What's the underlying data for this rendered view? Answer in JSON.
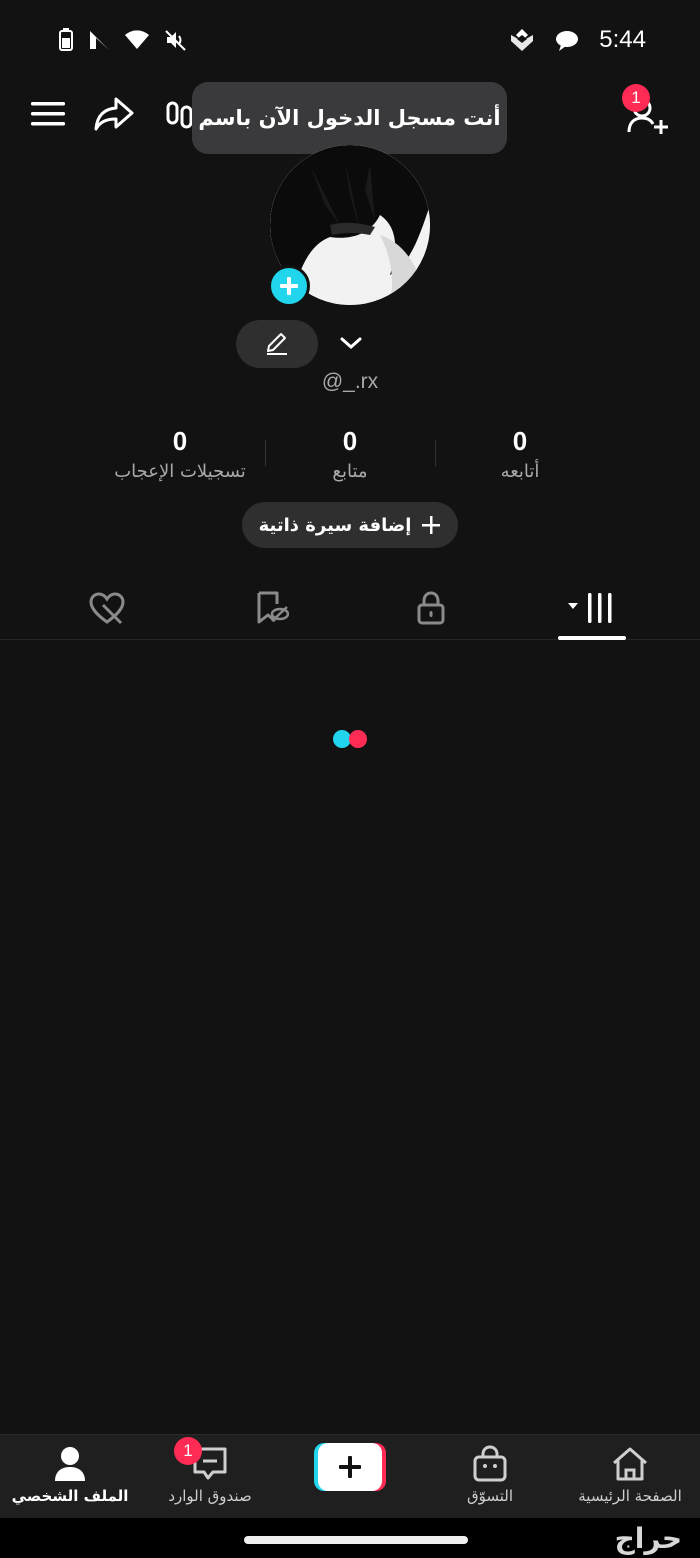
{
  "status_bar": {
    "time": "5:44",
    "left_icons": [
      "battery-saver-icon",
      "signal-icon",
      "wifi-icon",
      "mute-icon"
    ],
    "right_icons": [
      "notification-app-icon",
      "chat-bubble-icon"
    ]
  },
  "top_bar": {
    "menu_icon": "hamburger-menu-icon",
    "share_icon": "share-arrow-icon",
    "add_friend_badge": "1"
  },
  "tooltip": {
    "text": "أنت مسجل الدخول الآن باسم"
  },
  "profile": {
    "username": "@_.rx",
    "stats": [
      {
        "value": "0",
        "label": "أتابعه"
      },
      {
        "value": "0",
        "label": "متابع"
      },
      {
        "value": "0",
        "label": "تسجيلات الإعجاب"
      }
    ],
    "bio_button": "إضافة سيرة ذاتية"
  },
  "tabs": [
    {
      "name": "videos",
      "icon": "grid-icon",
      "active": true
    },
    {
      "name": "private",
      "icon": "lock-icon",
      "active": false
    },
    {
      "name": "favorites",
      "icon": "bookmark-hidden-icon",
      "active": false
    },
    {
      "name": "liked",
      "icon": "heart-hidden-icon",
      "active": false
    }
  ],
  "bottom_nav": {
    "home": "الصفحة الرئيسية",
    "shop": "التسوّق",
    "inbox": "صندوق الوارد",
    "inbox_badge": "1",
    "profile": "الملف الشخصي"
  },
  "watermark": "حراج",
  "colors": {
    "background": "#121212",
    "accent_cyan": "#20d5ec",
    "accent_red": "#fe2c55",
    "nav_bg": "#1f1f1f"
  }
}
